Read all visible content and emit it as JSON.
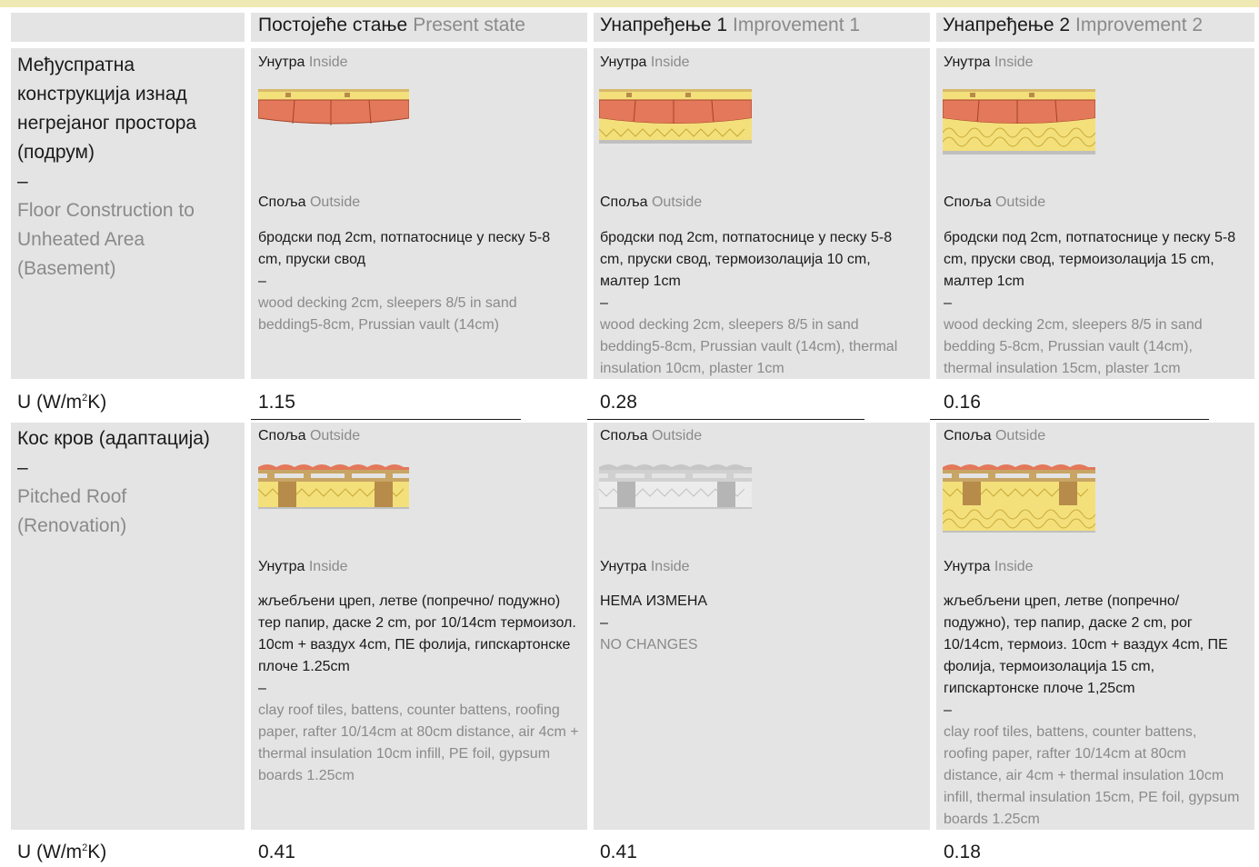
{
  "headers": [
    {
      "sr": "Постојеће стање",
      "en": "Present state"
    },
    {
      "sr": "Унапређење 1",
      "en": "Improvement 1"
    },
    {
      "sr": "Унапређење 2",
      "en": "Improvement 2"
    }
  ],
  "floor": {
    "label_sr": "Међуспратна конструкција изнад негрејаног простора (подрум)",
    "dash": "–",
    "label_en": "Floor Construction to Unheated Area (Basement)",
    "top_label": {
      "sr": "Унутра",
      "en": "Inside"
    },
    "bottom_label": {
      "sr": "Споља",
      "en": "Outside"
    },
    "cells": [
      {
        "sr": "бродски под 2cm, потпатоснице у песку 5-8 cm, пруски свод",
        "dash": "–",
        "en": "wood decking 2cm, sleepers 8/5 in sand bedding5-8cm, Prussian vault (14cm)"
      },
      {
        "sr": "бродски под 2cm, потпатоснице у песку 5-8 cm, пруски свод, термоизолација 10 cm, малтер 1cm",
        "dash": "–",
        "en": "wood decking 2cm, sleepers 8/5 in sand bedding5-8cm, Prussian vault (14cm), thermal insulation 10cm, plaster 1cm"
      },
      {
        "sr": "бродски под 2cm, потпатоснице у песку 5-8 cm, пруски свод, термоизолација 15 cm, малтер 1cm",
        "dash": "–",
        "en": "wood decking 2cm, sleepers 8/5 in sand bedding 5-8cm, Prussian vault (14cm), thermal insulation 15cm, plaster 1cm"
      }
    ],
    "u_label": "U (W/m",
    "u_label_sup": "2",
    "u_label_end": "K)",
    "u_values": [
      "1.15",
      "0.28",
      "0.16"
    ]
  },
  "roof": {
    "label_sr": "Кос кров (адаптација)",
    "dash": "–",
    "label_en": "Pitched Roof (Renovation)",
    "top_label": {
      "sr": "Споља",
      "en": "Outside"
    },
    "bottom_label": {
      "sr": "Унутра",
      "en": "Inside"
    },
    "cells": [
      {
        "sr": "жљебљени цреп, летве (попречно/ подужно) тер папир, даске 2 cm, рог 10/14cm термоизол. 10cm + ваздух 4cm, ПЕ фолија, гипскартонске плоче 1.25cm",
        "dash": "–",
        "en": "clay roof tiles, battens, counter battens, roofing paper, rafter 10/14cm at 80cm distance, air 4cm + thermal insulation 10cm infill, PE foil, gypsum boards 1.25cm"
      },
      {
        "sr": "НЕМА ИЗМЕНА",
        "dash": "–",
        "en": "NO CHANGES"
      },
      {
        "sr": "жљебљени цреп, летве (попречно/ подужно), тер папир, даске 2 cm, рог 10/14cm, термоиз. 10cm + ваздух 4cm, ПЕ фолија, термоизолација 15 cm, гипскартонске плоче 1,25cm",
        "dash": "–",
        "en": "clay roof tiles, battens, counter battens, roofing paper, rafter 10/14cm at 80cm distance, air 4cm + thermal insulation 10cm infill, thermal insulation 15cm, PE foil, gypsum boards 1.25cm"
      }
    ],
    "u_label": "U (W/m",
    "u_label_sup": "2",
    "u_label_end": "K)",
    "u_values": [
      "0.41",
      "0.41",
      "0.18"
    ]
  },
  "colors": {
    "accent_bar": "#efeab4",
    "cell_bg": "#e4e4e4",
    "brick": "#e3785a",
    "insulation": "#f3e07a",
    "timber": "#c8a564"
  }
}
